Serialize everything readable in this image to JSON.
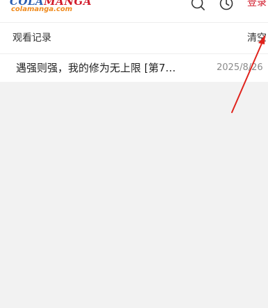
{
  "header": {
    "logo": {
      "primary_cola": "COLA",
      "primary_manga": "MANGA",
      "secondary": "colamanga.com"
    },
    "icons": {
      "search": "search-icon",
      "history": "clock-icon"
    },
    "login_label": "登录"
  },
  "section": {
    "title": "观看记录",
    "clear_label": "清空"
  },
  "history": {
    "items": [
      {
        "title": "遇强则强，我的修为无上限 [第7…",
        "date": "2025/8/26"
      }
    ]
  },
  "annotation": {
    "type": "arrow",
    "color": "#e0231c",
    "points_to": "clear-button"
  },
  "colors": {
    "brand_blue": "#2a5db0",
    "brand_red": "#d11a2a",
    "brand_orange": "#f08a1c",
    "empty_background": "#f2f2f2"
  }
}
